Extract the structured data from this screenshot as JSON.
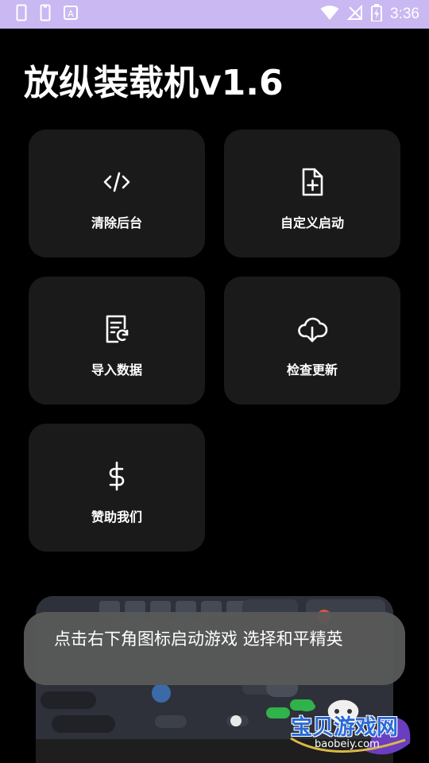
{
  "status_bar": {
    "time": "3:36",
    "left_icons": [
      "sim-card-icon",
      "sim-card-icon",
      "a-notification-icon"
    ],
    "right_icons": [
      "wifi-icon",
      "no-sim-icon",
      "battery-charging-icon"
    ]
  },
  "app": {
    "title": "放纵装载机v1.6"
  },
  "tiles": [
    {
      "label": "清除后台",
      "icon": "code-icon"
    },
    {
      "label": "自定义启动",
      "icon": "file-add-icon"
    },
    {
      "label": "导入数据",
      "icon": "document-sync-icon"
    },
    {
      "label": "检查更新",
      "icon": "cloud-download-icon"
    },
    {
      "label": "赞助我们",
      "icon": "dollar-icon"
    }
  ],
  "toast": {
    "message": "点击右下角图标启动游戏 选择和平精英"
  },
  "watermark": {
    "text": "宝贝游戏网",
    "sub": "baobeiy.com"
  },
  "colors": {
    "status_bar": "#c9b8f2",
    "background": "#000000",
    "tile": "#1a1a1a",
    "toast": "#585858"
  }
}
